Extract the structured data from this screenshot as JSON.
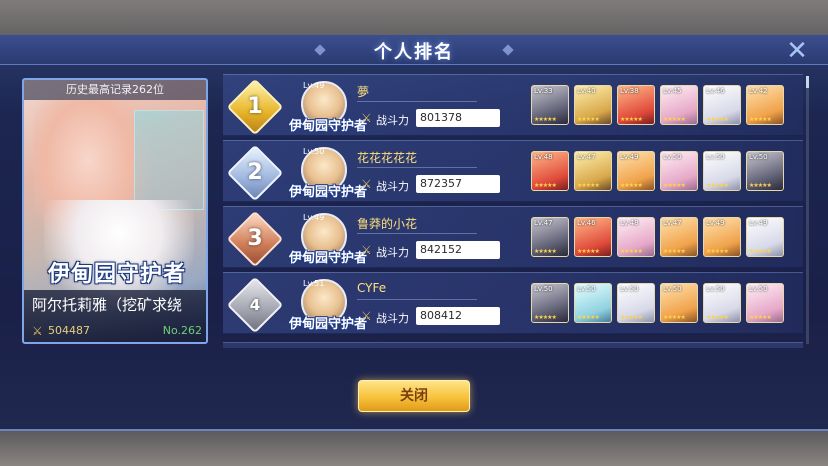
{
  "header": {
    "title": "个人排名"
  },
  "player_card": {
    "record": "历史最高记录262位",
    "team_logo": "伊甸园守护者",
    "name": "阿尔托莉雅（挖矿求绕",
    "power": "504487",
    "rank_no": "No.262"
  },
  "labels": {
    "power_label": "战斗力",
    "close_button": "关闭"
  },
  "rows": [
    {
      "rank": "1",
      "badge": "gold",
      "level": "Lv.49",
      "name": "夢",
      "power": "801378",
      "team_logo": "伊甸园守护者",
      "heroes": [
        {
          "lv": "Lv.33",
          "color": "h-dark"
        },
        {
          "lv": "Lv.40",
          "color": "h-gold"
        },
        {
          "lv": "Lv.38",
          "color": "h-red"
        },
        {
          "lv": "Lv.45",
          "color": "h-pink"
        },
        {
          "lv": "Lv.46",
          "color": "h-white"
        },
        {
          "lv": "Lv.42",
          "color": "h-orange"
        }
      ]
    },
    {
      "rank": "2",
      "badge": "silver",
      "level": "Lv.50",
      "name": "花花花花花",
      "power": "872357",
      "team_logo": "伊甸园守护者",
      "heroes": [
        {
          "lv": "Lv.48",
          "color": "h-red"
        },
        {
          "lv": "Lv.47",
          "color": "h-gold"
        },
        {
          "lv": "Lv.49",
          "color": "h-orange"
        },
        {
          "lv": "Lv.50",
          "color": "h-pink"
        },
        {
          "lv": "Lv.50",
          "color": "h-white"
        },
        {
          "lv": "Lv.50",
          "color": "h-dark"
        }
      ]
    },
    {
      "rank": "3",
      "badge": "bronze",
      "level": "Lv.49",
      "name": "鲁莽的小花",
      "power": "842152",
      "team_logo": "伊甸园守护者",
      "heroes": [
        {
          "lv": "Lv.47",
          "color": "h-dark"
        },
        {
          "lv": "Lv.46",
          "color": "h-red"
        },
        {
          "lv": "Lv.48",
          "color": "h-pink"
        },
        {
          "lv": "Lv.47",
          "color": "h-orange"
        },
        {
          "lv": "Lv.49",
          "color": "h-orange"
        },
        {
          "lv": "Lv.49",
          "color": "h-white"
        }
      ]
    },
    {
      "rank": "4",
      "badge": "plain",
      "level": "Lv.51",
      "name": "CYFe",
      "power": "808412",
      "team_logo": "伊甸园守护者",
      "heroes": [
        {
          "lv": "Lv.50",
          "color": "h-dark"
        },
        {
          "lv": "Lv.50",
          "color": "h-teal"
        },
        {
          "lv": "Lv.50",
          "color": "h-white"
        },
        {
          "lv": "Lv.50",
          "color": "h-orange"
        },
        {
          "lv": "Lv.50",
          "color": "h-white"
        },
        {
          "lv": "Lv.50",
          "color": "h-pink"
        }
      ]
    }
  ]
}
